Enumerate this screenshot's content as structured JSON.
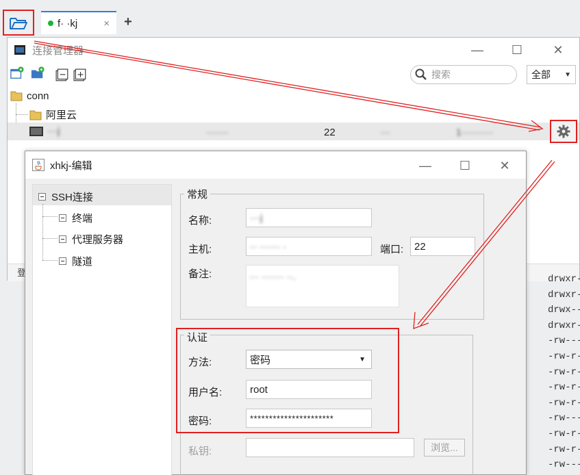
{
  "tabbar": {
    "tab_label": "f· ·kj",
    "tab_close": "×",
    "add_tab": "+"
  },
  "conn_manager": {
    "title": "连接管理器",
    "search_placeholder": "搜索",
    "filter_value": "全部",
    "tree": {
      "root": "conn",
      "folder": "阿里云",
      "session": {
        "name": "···j",
        "host": "·······",
        "port": "22",
        "user": "···",
        "note": "1··········"
      }
    },
    "bottom_label": "登"
  },
  "file_list": [
    "drwxr-",
    "drwxr-",
    "drwx--",
    "drwxr-",
    "-rw---",
    "-rw-r-",
    "-rw-r-",
    "-rw-r-",
    "-rw-r-",
    "-rw---",
    "-rw-r-",
    "-rw-r-",
    "-rw---"
  ],
  "edit_dialog": {
    "title": "xhkj-编辑",
    "nav": {
      "root": "SSH连接",
      "items": [
        "终端",
        "代理服务器",
        "隧道"
      ]
    },
    "general": {
      "legend": "常规",
      "name_label": "名称:",
      "name_value": "···j",
      "host_label": "主机:",
      "host_value": "·· ······ ·",
      "port_label": "端口:",
      "port_value": "22",
      "note_label": "备注:",
      "note_value": "··· ······· ··."
    },
    "auth": {
      "legend": "认证",
      "method_label": "方法:",
      "method_value": "密码",
      "user_label": "用户名:",
      "user_value": "root",
      "password_label": "密码:",
      "password_value": "**********************",
      "key_label": "私钥:",
      "key_value": "",
      "browse_label": "浏览..."
    }
  },
  "colors": {
    "annotation_red": "#e02020",
    "tab_accent": "#2f7ed8",
    "status_dot": "#18b534"
  }
}
